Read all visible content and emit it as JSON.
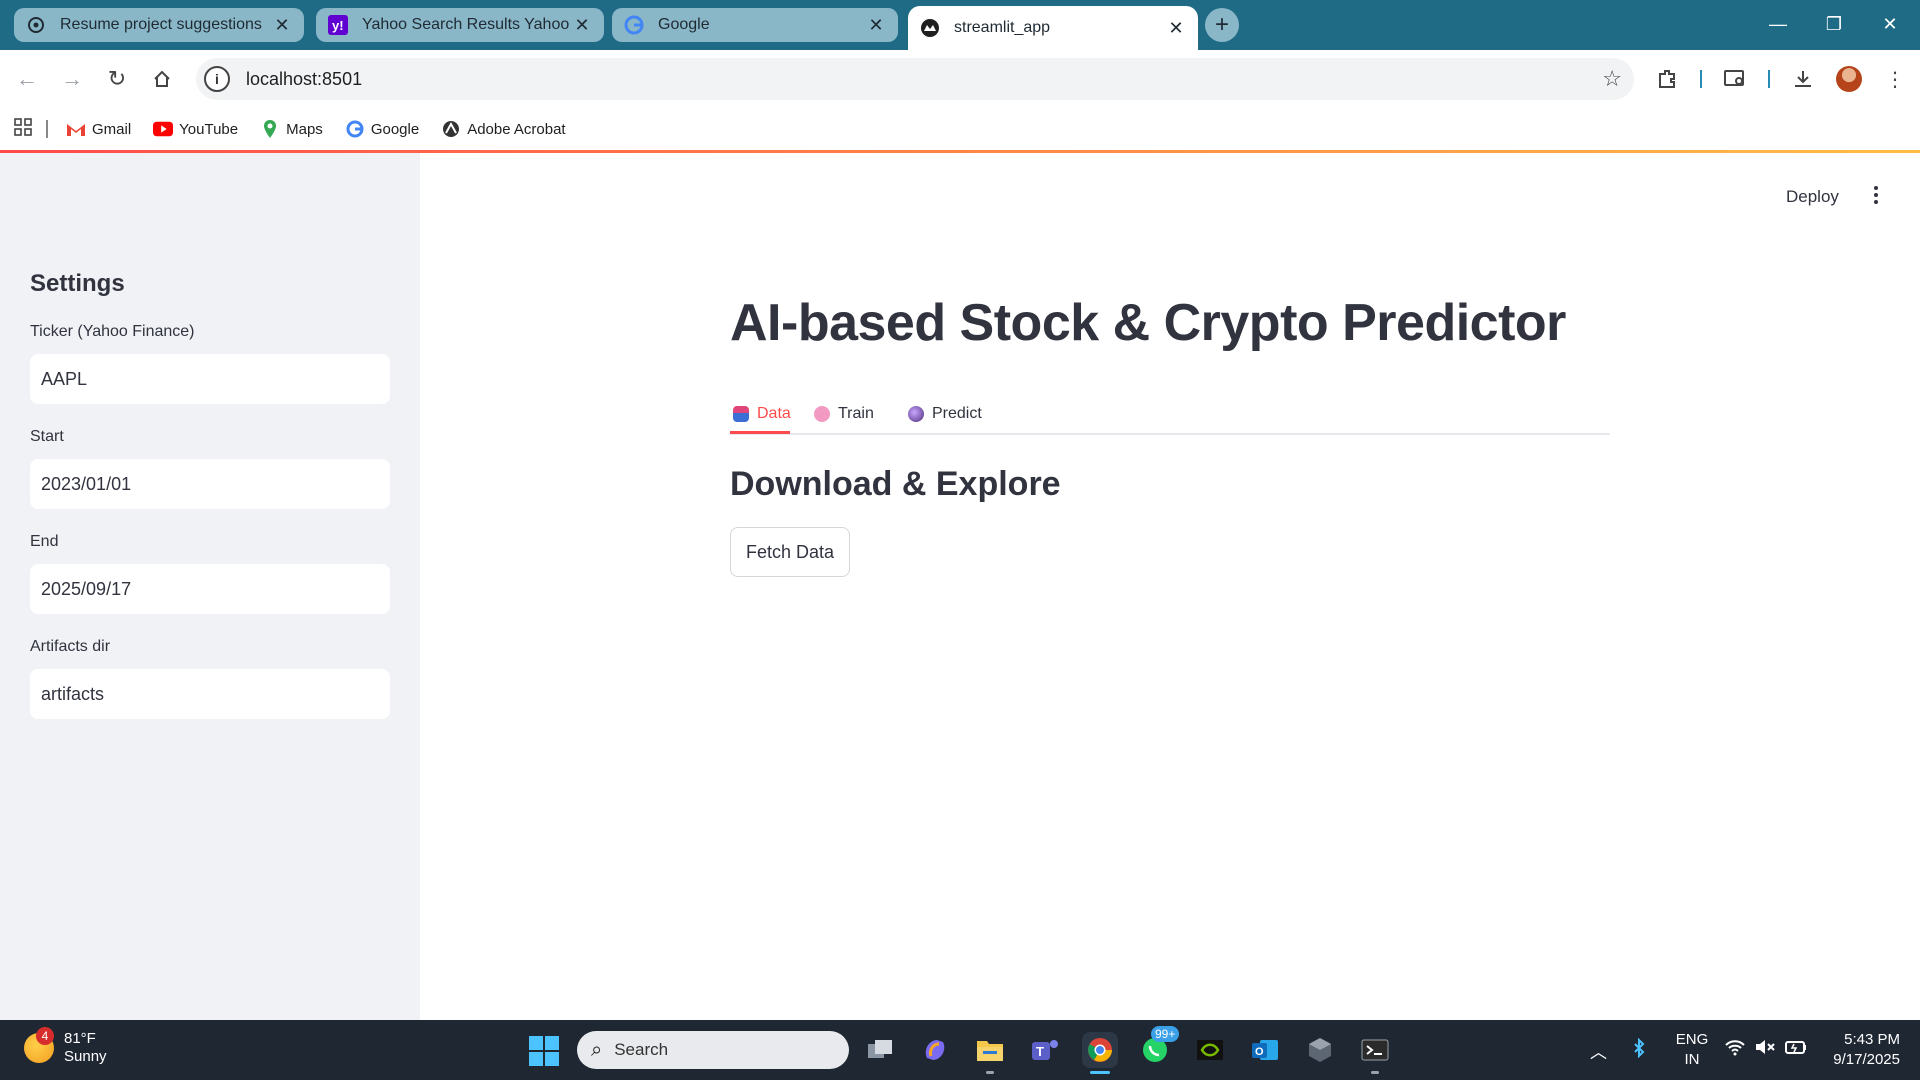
{
  "browser": {
    "tabs": [
      {
        "title": "Resume project suggestions",
        "icon": "openai-icon",
        "active": false
      },
      {
        "title": "Yahoo Search Results Yahoo India",
        "icon": "yahoo-icon",
        "active": false
      },
      {
        "title": "Google",
        "icon": "google-icon",
        "active": false
      },
      {
        "title": "streamlit_app",
        "icon": "streamlit-icon",
        "active": true
      }
    ],
    "url": "localhost:8501",
    "bookmarks": [
      {
        "label": "Gmail",
        "icon": "gmail-icon"
      },
      {
        "label": "YouTube",
        "icon": "youtube-icon"
      },
      {
        "label": "Maps",
        "icon": "maps-icon"
      },
      {
        "label": "Google",
        "icon": "google-icon"
      },
      {
        "label": "Adobe Acrobat",
        "icon": "acrobat-icon"
      }
    ]
  },
  "sidebar": {
    "title": "Settings",
    "fields": [
      {
        "label": "Ticker (Yahoo Finance)",
        "value": "AAPL"
      },
      {
        "label": "Start",
        "value": "2023/01/01"
      },
      {
        "label": "End",
        "value": "2025/09/17"
      },
      {
        "label": "Artifacts dir",
        "value": "artifacts"
      }
    ]
  },
  "header": {
    "deploy_label": "Deploy"
  },
  "main": {
    "title": "AI-based Stock & Crypto Predictor",
    "tabs": [
      {
        "label": "Data",
        "icon": "inbox-tray-icon",
        "active": true
      },
      {
        "label": "Train",
        "icon": "brain-icon",
        "active": false
      },
      {
        "label": "Predict",
        "icon": "crystal-ball-icon",
        "active": false
      }
    ],
    "section_title": "Download & Explore",
    "fetch_button": "Fetch Data"
  },
  "taskbar": {
    "weather": {
      "temp": "81°F",
      "condition": "Sunny",
      "badge": "4"
    },
    "search_placeholder": "Search",
    "whatsapp_badge": "99+",
    "language": {
      "line1": "ENG",
      "line2": "IN"
    },
    "time": "5:43 PM",
    "date": "9/17/2025"
  },
  "colors": {
    "accent": "#ff4b4b",
    "sidebar_bg": "#f0f2f6",
    "tabstrip": "#1f6b86",
    "text": "#31333f"
  }
}
